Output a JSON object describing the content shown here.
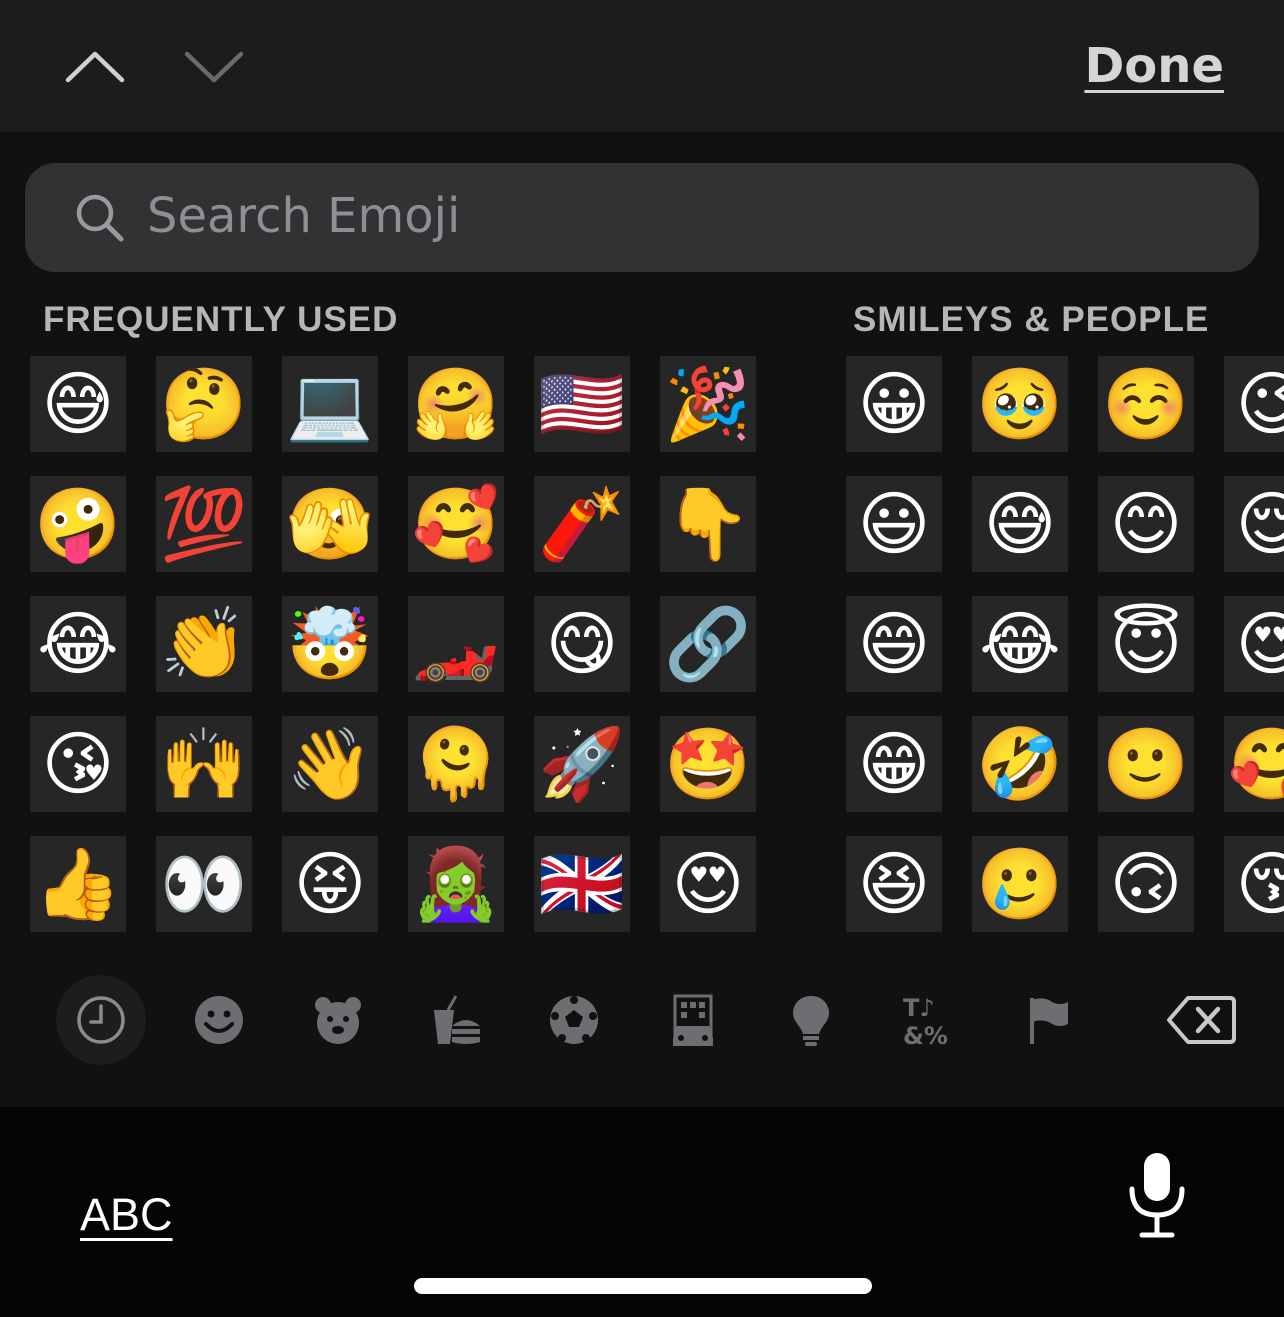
{
  "toolbar": {
    "prev_icon": "chevron-up-icon",
    "next_icon": "chevron-down-icon",
    "done_label": "Done"
  },
  "search": {
    "placeholder": "Search Emoji",
    "icon": "search-icon"
  },
  "sections": {
    "frequently_used": {
      "title": "FREQUENTLY USED",
      "emojis": [
        "😅",
        "🤔",
        "💻",
        "🤗",
        "🇺🇸",
        "🎉",
        "🤪",
        "💯",
        "🫣",
        "🥰",
        "🧨",
        "👇",
        "😂",
        "👏",
        "🤯",
        "🏎️",
        "😋",
        "🔗",
        "😘",
        "🙌",
        "👋",
        "🫠",
        "🚀",
        "🤩",
        "👍",
        "👀",
        "😝",
        "🧟‍♀️",
        "🇬🇧",
        "😍"
      ]
    },
    "smileys_people": {
      "title": "SMILEYS & PEOPLE",
      "emojis": [
        "😀",
        "🥹",
        "☺️",
        "😉",
        "😃",
        "😅",
        "😊",
        "😌",
        "😄",
        "😂",
        "😇",
        "😍",
        "😁",
        "🤣",
        "🙂",
        "🥰",
        "😆",
        "🥲",
        "🙃",
        "😚"
      ]
    }
  },
  "categories": [
    {
      "icon": "clock-icon",
      "active": true
    },
    {
      "icon": "smiley-icon",
      "active": false
    },
    {
      "icon": "bear-icon",
      "active": false
    },
    {
      "icon": "food-icon",
      "active": false
    },
    {
      "icon": "soccer-ball-icon",
      "active": false
    },
    {
      "icon": "building-car-icon",
      "active": false
    },
    {
      "icon": "lightbulb-icon",
      "active": false
    },
    {
      "icon": "symbols-icon",
      "active": false
    },
    {
      "icon": "flag-icon",
      "active": false
    },
    {
      "icon": "delete-icon",
      "active": false
    }
  ],
  "bottom": {
    "abc_label": "ABC",
    "mic_icon": "microphone-icon"
  },
  "colors": {
    "toolbar_bg": "#1c1c1e",
    "keyboard_bg": "#111112",
    "search_bg": "#323234",
    "placeholder": "#8e8e93",
    "section_label": "#b6b6b6"
  }
}
